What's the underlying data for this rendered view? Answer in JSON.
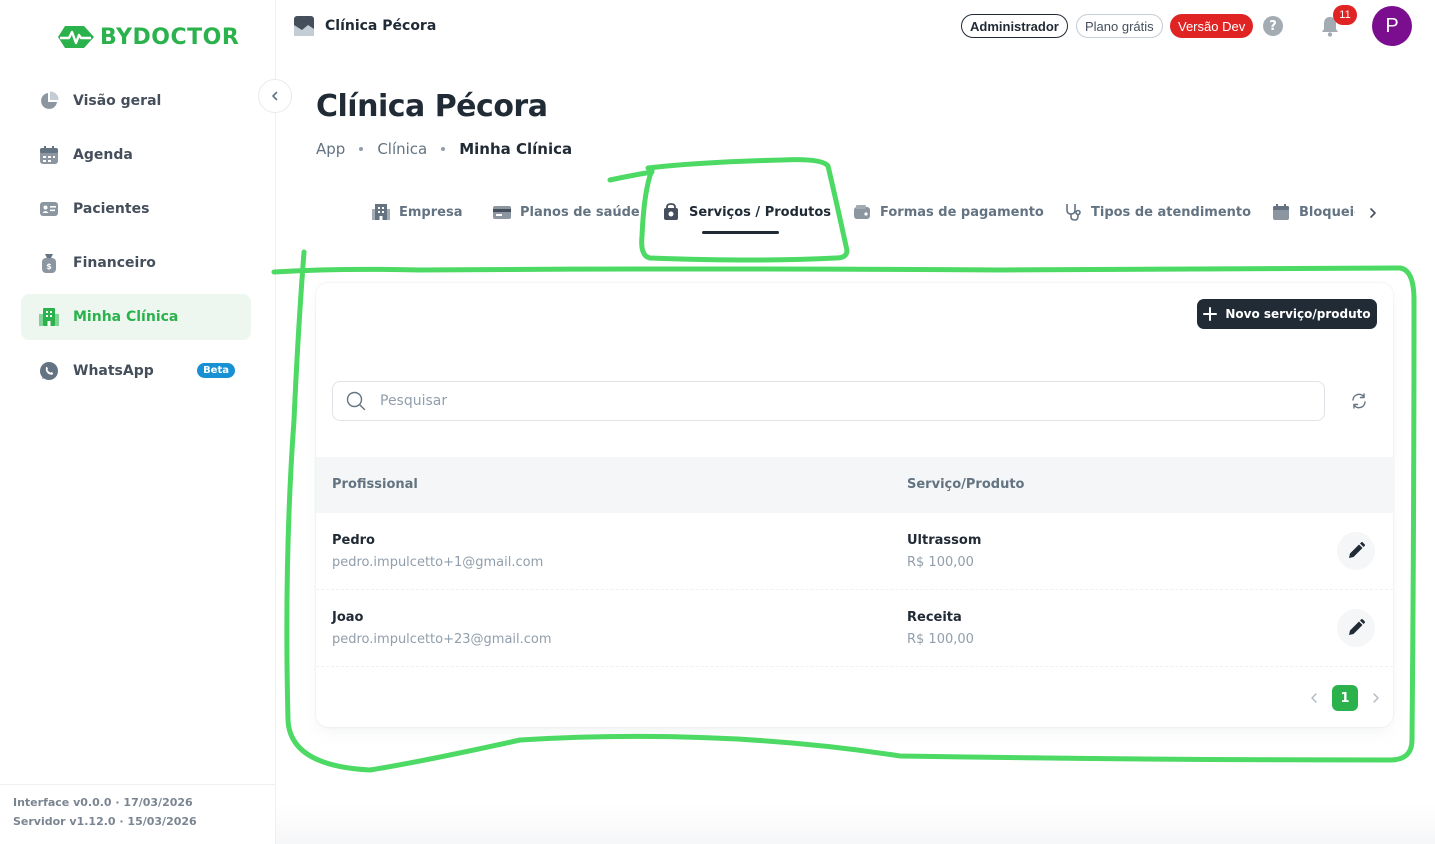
{
  "brand": {
    "name": "BYDOCTOR",
    "color": "#2bb24c"
  },
  "sidebar": {
    "items": [
      {
        "label": "Visão geral",
        "icon": "pie-chart-icon"
      },
      {
        "label": "Agenda",
        "icon": "calendar-icon"
      },
      {
        "label": "Pacientes",
        "icon": "id-card-icon"
      },
      {
        "label": "Financeiro",
        "icon": "money-bag-icon"
      },
      {
        "label": "Minha Clínica",
        "icon": "building-icon",
        "active": true
      },
      {
        "label": "WhatsApp",
        "icon": "whatsapp-icon",
        "badge": "Beta"
      }
    ],
    "footer": {
      "interface": "Interface v0.0.0 · 17/03/2026",
      "server": "Servidor v1.12.0 · 15/03/2026"
    }
  },
  "topbar": {
    "app_title": "Clínica Pécora",
    "role": "Administrador",
    "plan": "Plano grátis",
    "version": "Versão Dev",
    "help": "?",
    "notifications": "11",
    "avatar_initial": "P"
  },
  "page": {
    "title": "Clínica Pécora",
    "breadcrumb": [
      "App",
      "Clínica",
      "Minha Clínica"
    ]
  },
  "tabs": [
    {
      "label": "Empresa",
      "icon": "building-icon"
    },
    {
      "label": "Planos de saúde",
      "icon": "card-icon"
    },
    {
      "label": "Serviços / Produtos",
      "icon": "bag-icon",
      "active": true
    },
    {
      "label": "Formas de pagamento",
      "icon": "wallet-icon"
    },
    {
      "label": "Tipos de atendimento",
      "icon": "stethoscope-icon"
    },
    {
      "label": "Bloqueios",
      "icon": "calendar-icon"
    }
  ],
  "toolbar": {
    "new_label": "Novo serviço/produto"
  },
  "search": {
    "placeholder": "Pesquisar"
  },
  "table": {
    "columns": [
      "Profissional",
      "Serviço/Produto"
    ],
    "rows": [
      {
        "name": "Pedro",
        "email": "pedro.impulcetto+1@gmail.com",
        "service": "Ultrassom",
        "price": "R$ 100,00"
      },
      {
        "name": "Joao",
        "email": "pedro.impulcetto+23@gmail.com",
        "service": "Receita",
        "price": "R$ 100,00"
      }
    ]
  },
  "pagination": {
    "current": "1"
  },
  "colors": {
    "accent": "#2bb24c",
    "dark": "#212b36",
    "danger": "#e02424",
    "annotation": "#4cd964"
  }
}
